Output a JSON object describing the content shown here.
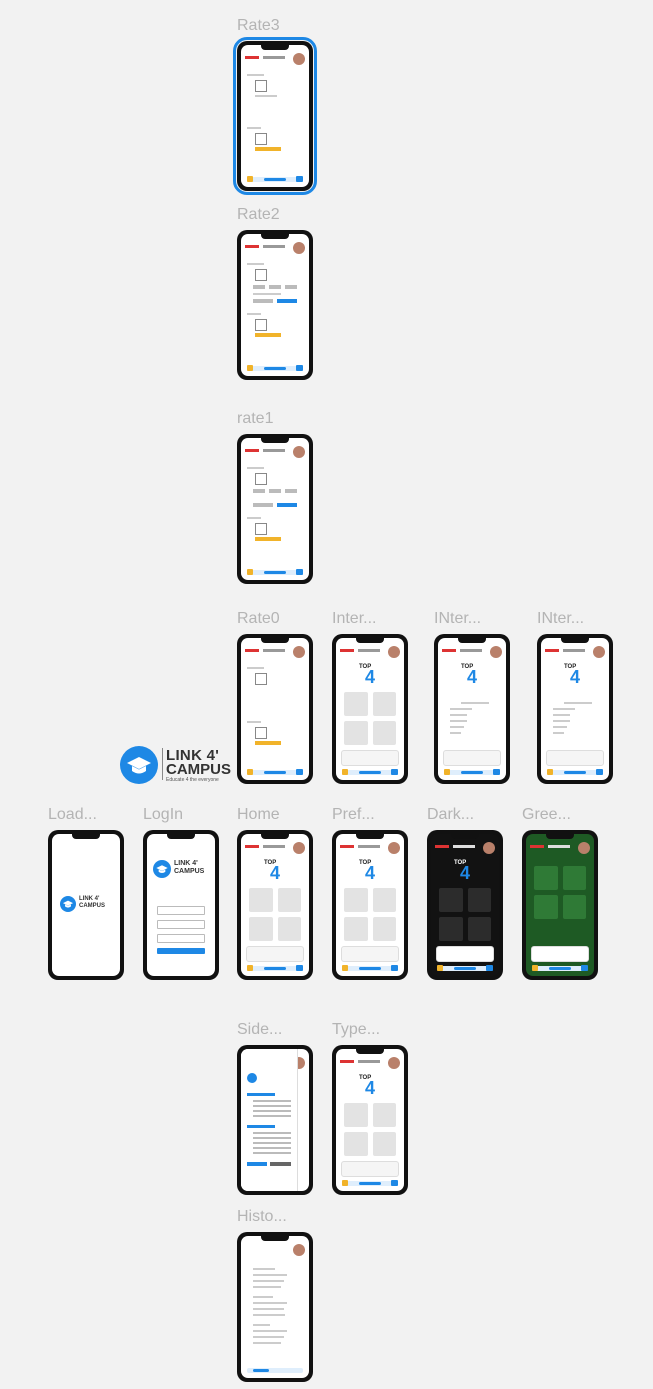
{
  "frames": {
    "rate3": "Rate3",
    "rate2": "Rate2",
    "rate1": "rate1",
    "rate0": "Rate0",
    "inter1": "Inter...",
    "inter2": "INter...",
    "inter3": "INter...",
    "loading": "Load...",
    "login": "LogIn",
    "home": "Home",
    "pref": "Pref...",
    "dark": "Dark...",
    "green": "Gree...",
    "side": "Side...",
    "type": "Type...",
    "history": "Histo..."
  },
  "logo": {
    "line1": "LINK 4'",
    "line2": "CAMPUS",
    "tagline": "Educate 4 the everyone"
  },
  "mockup": {
    "top": "TOP",
    "four": "4"
  },
  "colors": {
    "accent": "#1e88e5",
    "brand_red": "#dd3333",
    "star": "#f1b32a",
    "selection": "#1e88e5"
  }
}
